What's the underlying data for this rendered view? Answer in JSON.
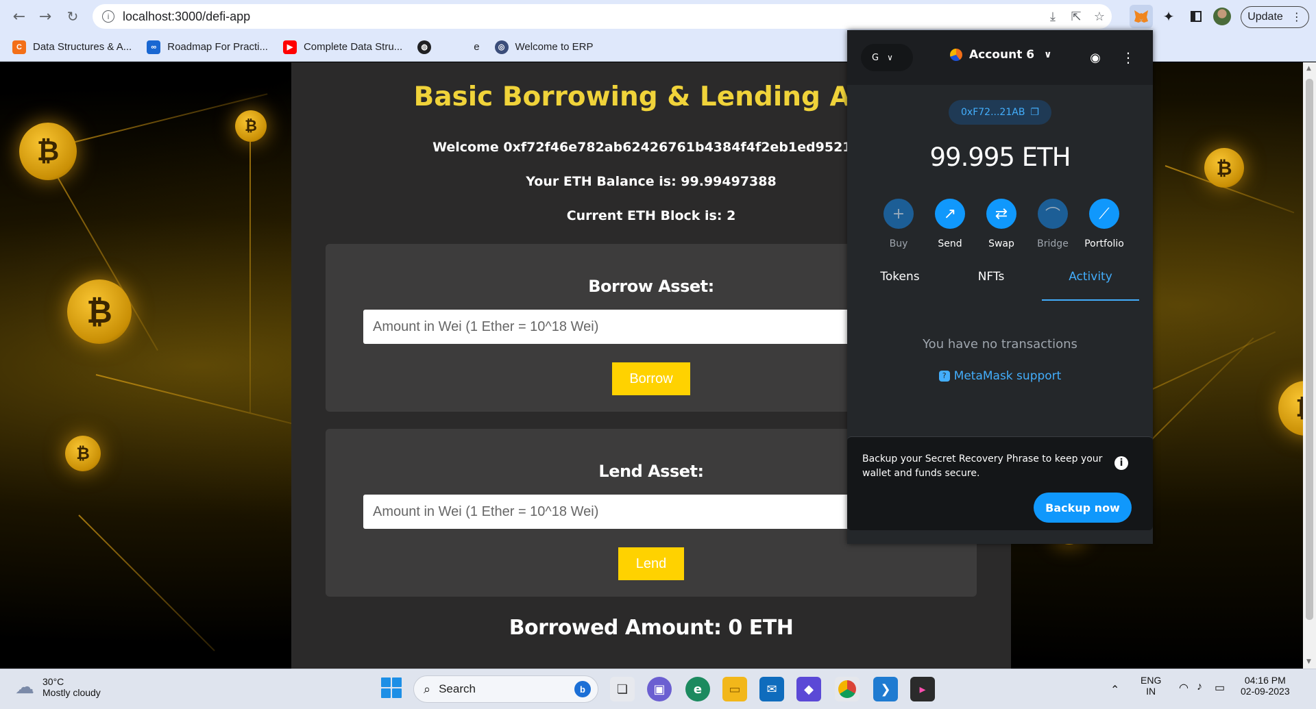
{
  "browser": {
    "url": "localhost:3000/defi-app",
    "update_label": "Update",
    "bookmarks": [
      {
        "label": "Data Structures & A...",
        "color": "#f36f18",
        "glyph": "C"
      },
      {
        "label": "Roadmap For Practi...",
        "color": "#1967d2",
        "glyph": "∞"
      },
      {
        "label": "Complete Data Stru...",
        "color": "#ff0000",
        "glyph": "▶"
      },
      {
        "label": "",
        "color": "#202124",
        "glyph": "◍"
      },
      {
        "label": "e",
        "color": "transparent",
        "glyph": ""
      },
      {
        "label": "Welcome to ERP",
        "color": "#3b4d7a",
        "glyph": "◎"
      }
    ]
  },
  "app": {
    "title": "Basic Borrowing & Lending App",
    "welcome": "Welcome 0xf72f46e782ab62426761b4384f4f2eb1ed9521ab",
    "balance": "Your ETH Balance is: 99.99497388",
    "block": "Current ETH Block is: 2",
    "borrow": {
      "heading": "Borrow Asset:",
      "placeholder": "Amount in Wei (1 Ether = 10^18 Wei)",
      "button": "Borrow"
    },
    "lend": {
      "heading": "Lend Asset:",
      "placeholder": "Amount in Wei (1 Ether = 10^18 Wei)",
      "button": "Lend"
    },
    "borrowed": "Borrowed Amount: 0 ETH"
  },
  "metamask": {
    "network_short": "G",
    "account": "Account 6",
    "address": "0xF72...21AB",
    "balance": "99.995 ETH",
    "actions": [
      {
        "label": "Buy",
        "icon": "plus-icon",
        "glyph": "+",
        "dim": true
      },
      {
        "label": "Send",
        "icon": "arrow-up-right-icon",
        "glyph": "↗",
        "dim": false
      },
      {
        "label": "Swap",
        "icon": "swap-icon",
        "glyph": "⇄",
        "dim": false
      },
      {
        "label": "Bridge",
        "icon": "bridge-icon",
        "glyph": "⌒",
        "dim": true
      },
      {
        "label": "Portfolio",
        "icon": "chart-icon",
        "glyph": "⟋",
        "dim": false
      }
    ],
    "tabs": [
      "Tokens",
      "NFTs",
      "Activity"
    ],
    "active_tab": "Activity",
    "empty_text": "You have no transactions",
    "support_link": "MetaMask support",
    "backup_text": "Backup your Secret Recovery Phrase to keep your wallet and funds secure.",
    "backup_button": "Backup now"
  },
  "taskbar": {
    "temperature": "30°C",
    "weather": "Mostly cloudy",
    "search": "Search",
    "lang1": "ENG",
    "lang2": "IN",
    "time": "04:16 PM",
    "date": "02-09-2023"
  },
  "colors": {
    "accent_yellow": "#ffd200",
    "title_yellow": "#f0d33a",
    "metamask_blue": "#1098fc"
  }
}
